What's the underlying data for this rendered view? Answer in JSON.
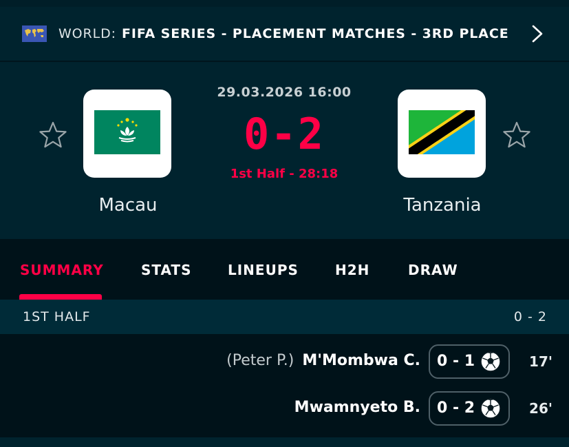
{
  "competition": {
    "country": "WORLD:",
    "name": "FIFA SERIES - PLACEMENT MATCHES - 3RD PLACE",
    "flag_icon": "world-map-flag-icon",
    "chevron_icon": "chevron-right-icon"
  },
  "match": {
    "datetime": "29.03.2026 16:00",
    "score": "0-2",
    "status": "1st Half - 28:18",
    "home": {
      "name": "Macau",
      "favorite_icon": "star-outline-icon"
    },
    "away": {
      "name": "Tanzania",
      "favorite_icon": "star-outline-icon"
    }
  },
  "tabs": [
    {
      "label": "SUMMARY",
      "active": true
    },
    {
      "label": "STATS",
      "active": false
    },
    {
      "label": "LINEUPS",
      "active": false
    },
    {
      "label": "H2H",
      "active": false
    },
    {
      "label": "DRAW",
      "active": false
    }
  ],
  "summary": {
    "period_label": "1ST HALF",
    "period_score": "0 - 2",
    "events": [
      {
        "assist": "(Peter P.)",
        "scorer": "M'Mombwa C.",
        "score": "0 - 1",
        "minute": "17'",
        "icon": "soccer-ball-icon"
      },
      {
        "assist": "",
        "scorer": "Mwamnyeto B.",
        "score": "0 - 2",
        "minute": "26'",
        "icon": "soccer-ball-icon"
      }
    ]
  },
  "colors": {
    "accent": "#ff0046",
    "background": "#001e28",
    "panel": "#00232e",
    "tab_bar": "#001219"
  }
}
